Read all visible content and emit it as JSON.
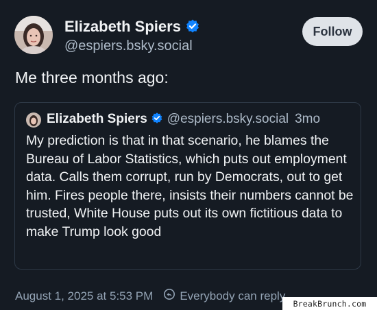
{
  "author": {
    "name": "Elizabeth Spiers",
    "handle": "@espiers.bsky.social",
    "follow_label": "Follow"
  },
  "post": {
    "text": "Me three months ago:",
    "timestamp": "August 1, 2025 at 5:53 PM",
    "reply_setting": "Everybody can reply"
  },
  "quote": {
    "name": "Elizabeth Spiers",
    "handle": "@espiers.bsky.social",
    "time": "3mo",
    "body": "My prediction is that in that scenario, he blames the Bureau of Labor Statistics, which puts out employment data. Calls them corrupt, run by Democrats, out to get him. Fires people there, insists their numbers cannot be trusted, White House puts out its own fictitious data to make Trump look good"
  },
  "watermark": "BreakBrunch.com",
  "icons": {
    "verified": "verified-check-icon",
    "reply_setting": "reply-setting-icon"
  },
  "colors": {
    "background": "#151b23",
    "verified": "#1083fe",
    "secondary_text": "#aebbc9"
  }
}
